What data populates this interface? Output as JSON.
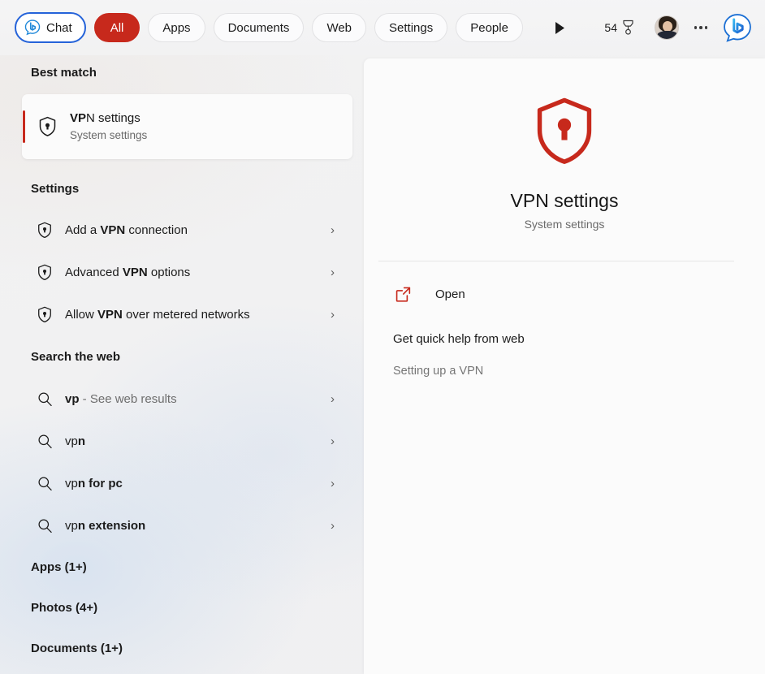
{
  "topbar": {
    "chat_pill": {
      "label": "Chat",
      "icon": "bing-chat-icon"
    },
    "filters": [
      {
        "label": "All",
        "active": true
      },
      {
        "label": "Apps",
        "active": false
      },
      {
        "label": "Documents",
        "active": false
      },
      {
        "label": "Web",
        "active": false
      },
      {
        "label": "Settings",
        "active": false
      },
      {
        "label": "People",
        "active": false
      },
      {
        "label": "",
        "active": false,
        "clipped": true
      }
    ],
    "scroll_forward_icon": "play-arrow-icon",
    "rewards": {
      "points": "54",
      "icon": "rewards-medal-icon"
    },
    "avatar_icon": "user-avatar",
    "more_icon": "ellipsis-icon",
    "bing_icon": "bing-logo-icon",
    "accent_red": "#c7291c",
    "accent_blue": "#2563d9"
  },
  "results": {
    "best_match_heading": "Best match",
    "best_match": {
      "icon": "shield-lock-icon",
      "title_bold": "VP",
      "title_rest": "N settings",
      "subtitle": "System settings"
    },
    "settings_heading": "Settings",
    "settings_items": [
      {
        "icon": "shield-lock-icon",
        "pre": "Add a ",
        "bold": "VPN",
        "post": " connection",
        "chevron": "›"
      },
      {
        "icon": "shield-lock-icon",
        "pre": "Advanced ",
        "bold": "VPN",
        "post": " options",
        "chevron": "›"
      },
      {
        "icon": "shield-lock-icon",
        "pre": "Allow ",
        "bold": "VPN",
        "post": " over metered networks",
        "chevron": "›"
      }
    ],
    "web_heading": "Search the web",
    "web_items": [
      {
        "icon": "search-icon",
        "bold": "vp",
        "post": "",
        "dim": " - See web results",
        "chevron": "›"
      },
      {
        "icon": "search-icon",
        "bold": "vp",
        "post": "n",
        "dim": "",
        "chevron": "›"
      },
      {
        "icon": "search-icon",
        "bold": "vp",
        "post": "n for pc",
        "dim": "",
        "chevron": "›"
      },
      {
        "icon": "search-icon",
        "bold": "vp",
        "post": "n extension",
        "dim": "",
        "chevron": "›"
      }
    ],
    "groups": [
      {
        "label": "Apps (1+)"
      },
      {
        "label": "Photos (4+)"
      },
      {
        "label": "Documents (1+)"
      }
    ]
  },
  "preview": {
    "hero_icon": "shield-lock-icon",
    "title": "VPN settings",
    "subtitle": "System settings",
    "open": {
      "icon": "open-external-icon",
      "label": "Open"
    },
    "help_heading": "Get quick help from web",
    "help_links": [
      {
        "label": "Setting up a VPN"
      }
    ]
  }
}
